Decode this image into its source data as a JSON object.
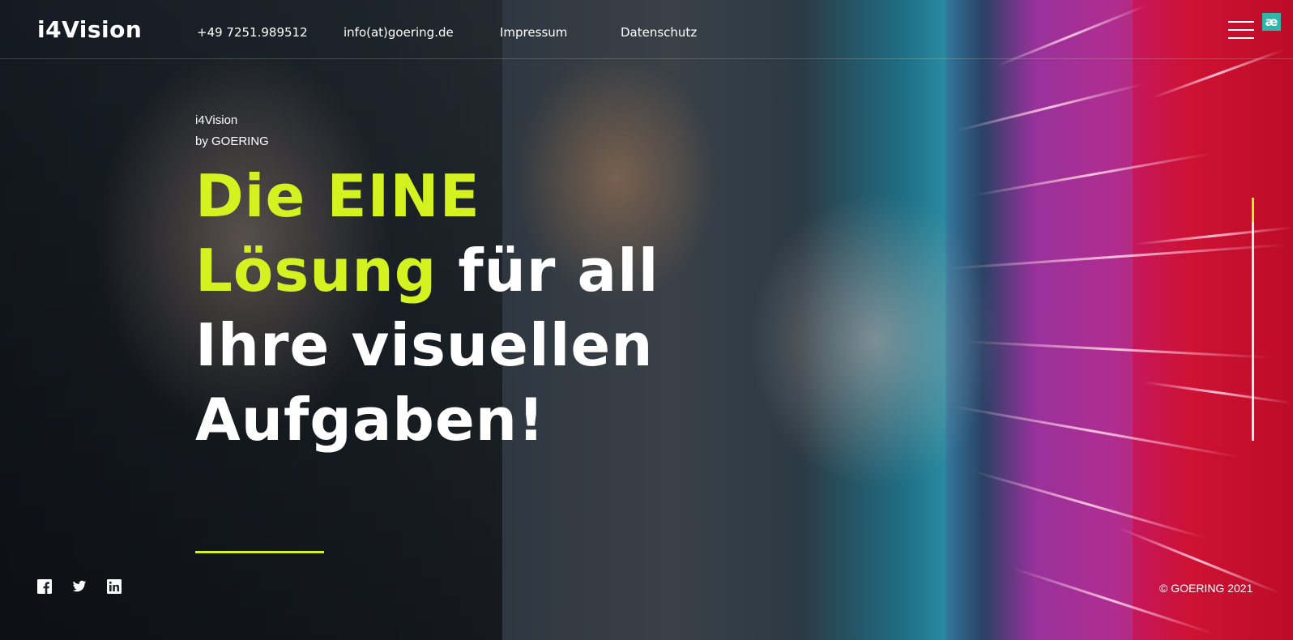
{
  "brand": {
    "logo": "i4Vision"
  },
  "nav": {
    "phone": "+49 7251.989512",
    "email": "info(at)goering.de",
    "impressum": "Impressum",
    "datenschutz": "Datenschutz"
  },
  "badge": {
    "text": "æ"
  },
  "hero": {
    "kicker_line1": "i4Vision",
    "kicker_line2": "by GOERING",
    "headline_part1": "Die EINE",
    "headline_part2": "Lösung",
    "headline_part3": " für all",
    "headline_part4": "Ihre visuellen",
    "headline_part5": "Aufgaben!"
  },
  "social": {
    "icons": [
      "facebook-icon",
      "twitter-icon",
      "linkedin-icon"
    ]
  },
  "footer": {
    "copyright": "© GOERING 2021"
  },
  "colors": {
    "accent": "#d4f21f",
    "text": "#ffffff",
    "badge": "#2eb7a9"
  }
}
